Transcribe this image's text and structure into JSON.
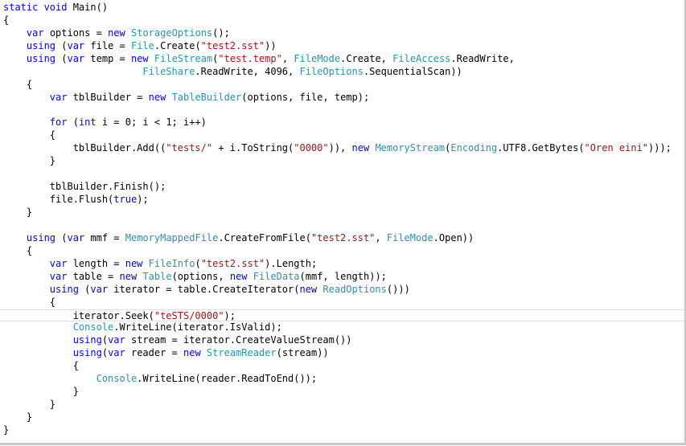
{
  "editor": {
    "current_line": 24,
    "lines": [
      [
        {
          "t": "static void",
          "c": "kw"
        },
        {
          "t": " Main()"
        }
      ],
      [
        {
          "t": "{"
        }
      ],
      [
        {
          "t": "    "
        },
        {
          "t": "var",
          "c": "kw"
        },
        {
          "t": " options = "
        },
        {
          "t": "new",
          "c": "kw"
        },
        {
          "t": " "
        },
        {
          "t": "StorageOptions",
          "c": "ty"
        },
        {
          "t": "();"
        }
      ],
      [
        {
          "t": "    "
        },
        {
          "t": "using",
          "c": "kw"
        },
        {
          "t": " ("
        },
        {
          "t": "var",
          "c": "kw"
        },
        {
          "t": " file = "
        },
        {
          "t": "File",
          "c": "ty"
        },
        {
          "t": ".Create("
        },
        {
          "t": "\"test2.sst\"",
          "c": "st"
        },
        {
          "t": "))"
        }
      ],
      [
        {
          "t": "    "
        },
        {
          "t": "using",
          "c": "kw"
        },
        {
          "t": " ("
        },
        {
          "t": "var",
          "c": "kw"
        },
        {
          "t": " temp = "
        },
        {
          "t": "new",
          "c": "kw"
        },
        {
          "t": " "
        },
        {
          "t": "FileStream",
          "c": "ty"
        },
        {
          "t": "("
        },
        {
          "t": "\"test.temp\"",
          "c": "st"
        },
        {
          "t": ", "
        },
        {
          "t": "FileMode",
          "c": "ty"
        },
        {
          "t": ".Create, "
        },
        {
          "t": "FileAccess",
          "c": "ty"
        },
        {
          "t": ".ReadWrite,"
        }
      ],
      [
        {
          "t": "                        "
        },
        {
          "t": "FileShare",
          "c": "ty"
        },
        {
          "t": ".ReadWrite, 4096, "
        },
        {
          "t": "FileOptions",
          "c": "ty"
        },
        {
          "t": ".SequentialScan))"
        }
      ],
      [
        {
          "t": "    {"
        }
      ],
      [
        {
          "t": "        "
        },
        {
          "t": "var",
          "c": "kw"
        },
        {
          "t": " tblBuilder = "
        },
        {
          "t": "new",
          "c": "kw"
        },
        {
          "t": " "
        },
        {
          "t": "TableBuilder",
          "c": "ty"
        },
        {
          "t": "(options, file, temp);"
        }
      ],
      [],
      [
        {
          "t": "        "
        },
        {
          "t": "for",
          "c": "kw"
        },
        {
          "t": " ("
        },
        {
          "t": "int",
          "c": "kw"
        },
        {
          "t": " i = 0; i < 1; i++)"
        }
      ],
      [
        {
          "t": "        {"
        }
      ],
      [
        {
          "t": "            tblBuilder.Add(("
        },
        {
          "t": "\"tests/\"",
          "c": "st"
        },
        {
          "t": " + i.ToString("
        },
        {
          "t": "\"0000\"",
          "c": "st"
        },
        {
          "t": ")), "
        },
        {
          "t": "new",
          "c": "kw"
        },
        {
          "t": " "
        },
        {
          "t": "MemoryStream",
          "c": "ty"
        },
        {
          "t": "("
        },
        {
          "t": "Encoding",
          "c": "ty"
        },
        {
          "t": ".UTF8.GetBytes("
        },
        {
          "t": "\"Oren eini\"",
          "c": "st"
        },
        {
          "t": ")));"
        }
      ],
      [
        {
          "t": "        }"
        }
      ],
      [],
      [
        {
          "t": "        tblBuilder.Finish();"
        }
      ],
      [
        {
          "t": "        file.Flush("
        },
        {
          "t": "true",
          "c": "kw"
        },
        {
          "t": ");"
        }
      ],
      [
        {
          "t": "    }"
        }
      ],
      [],
      [
        {
          "t": "    "
        },
        {
          "t": "using",
          "c": "kw"
        },
        {
          "t": " ("
        },
        {
          "t": "var",
          "c": "kw"
        },
        {
          "t": " mmf = "
        },
        {
          "t": "MemoryMappedFile",
          "c": "ty"
        },
        {
          "t": ".CreateFromFile("
        },
        {
          "t": "\"test2.sst\"",
          "c": "st"
        },
        {
          "t": ", "
        },
        {
          "t": "FileMode",
          "c": "ty"
        },
        {
          "t": ".Open))"
        }
      ],
      [
        {
          "t": "    {"
        }
      ],
      [
        {
          "t": "        "
        },
        {
          "t": "var",
          "c": "kw"
        },
        {
          "t": " length = "
        },
        {
          "t": "new",
          "c": "kw"
        },
        {
          "t": " "
        },
        {
          "t": "FileInfo",
          "c": "ty"
        },
        {
          "t": "("
        },
        {
          "t": "\"test2.sst\"",
          "c": "st"
        },
        {
          "t": ").Length;"
        }
      ],
      [
        {
          "t": "        "
        },
        {
          "t": "var",
          "c": "kw"
        },
        {
          "t": " table = "
        },
        {
          "t": "new",
          "c": "kw"
        },
        {
          "t": " "
        },
        {
          "t": "Table",
          "c": "ty"
        },
        {
          "t": "(options, "
        },
        {
          "t": "new",
          "c": "kw"
        },
        {
          "t": " "
        },
        {
          "t": "FileData",
          "c": "ty"
        },
        {
          "t": "(mmf, length));"
        }
      ],
      [
        {
          "t": "        "
        },
        {
          "t": "using",
          "c": "kw"
        },
        {
          "t": " ("
        },
        {
          "t": "var",
          "c": "kw"
        },
        {
          "t": " iterator = table.CreateIterator("
        },
        {
          "t": "new",
          "c": "kw"
        },
        {
          "t": " "
        },
        {
          "t": "ReadOptions",
          "c": "ty"
        },
        {
          "t": "()))"
        }
      ],
      [
        {
          "t": "        {"
        }
      ],
      [
        {
          "t": "            iterator.Seek("
        },
        {
          "t": "\"teSTS/0000\"",
          "c": "st"
        },
        {
          "t": ");"
        }
      ],
      [
        {
          "t": "            "
        },
        {
          "t": "Console",
          "c": "ty"
        },
        {
          "t": ".WriteLine(iterator.IsValid);"
        }
      ],
      [
        {
          "t": "            "
        },
        {
          "t": "using",
          "c": "kw"
        },
        {
          "t": "("
        },
        {
          "t": "var",
          "c": "kw"
        },
        {
          "t": " stream = iterator.CreateValueStream())"
        }
      ],
      [
        {
          "t": "            "
        },
        {
          "t": "using",
          "c": "kw"
        },
        {
          "t": "("
        },
        {
          "t": "var",
          "c": "kw"
        },
        {
          "t": " reader = "
        },
        {
          "t": "new",
          "c": "kw"
        },
        {
          "t": " "
        },
        {
          "t": "StreamReader",
          "c": "ty"
        },
        {
          "t": "(stream))"
        }
      ],
      [
        {
          "t": "            {"
        }
      ],
      [
        {
          "t": "                "
        },
        {
          "t": "Console",
          "c": "ty"
        },
        {
          "t": ".WriteLine(reader.ReadToEnd());"
        }
      ],
      [
        {
          "t": "            }"
        }
      ],
      [
        {
          "t": "        }"
        }
      ],
      [
        {
          "t": "    }"
        }
      ],
      [
        {
          "t": "}"
        }
      ]
    ]
  }
}
